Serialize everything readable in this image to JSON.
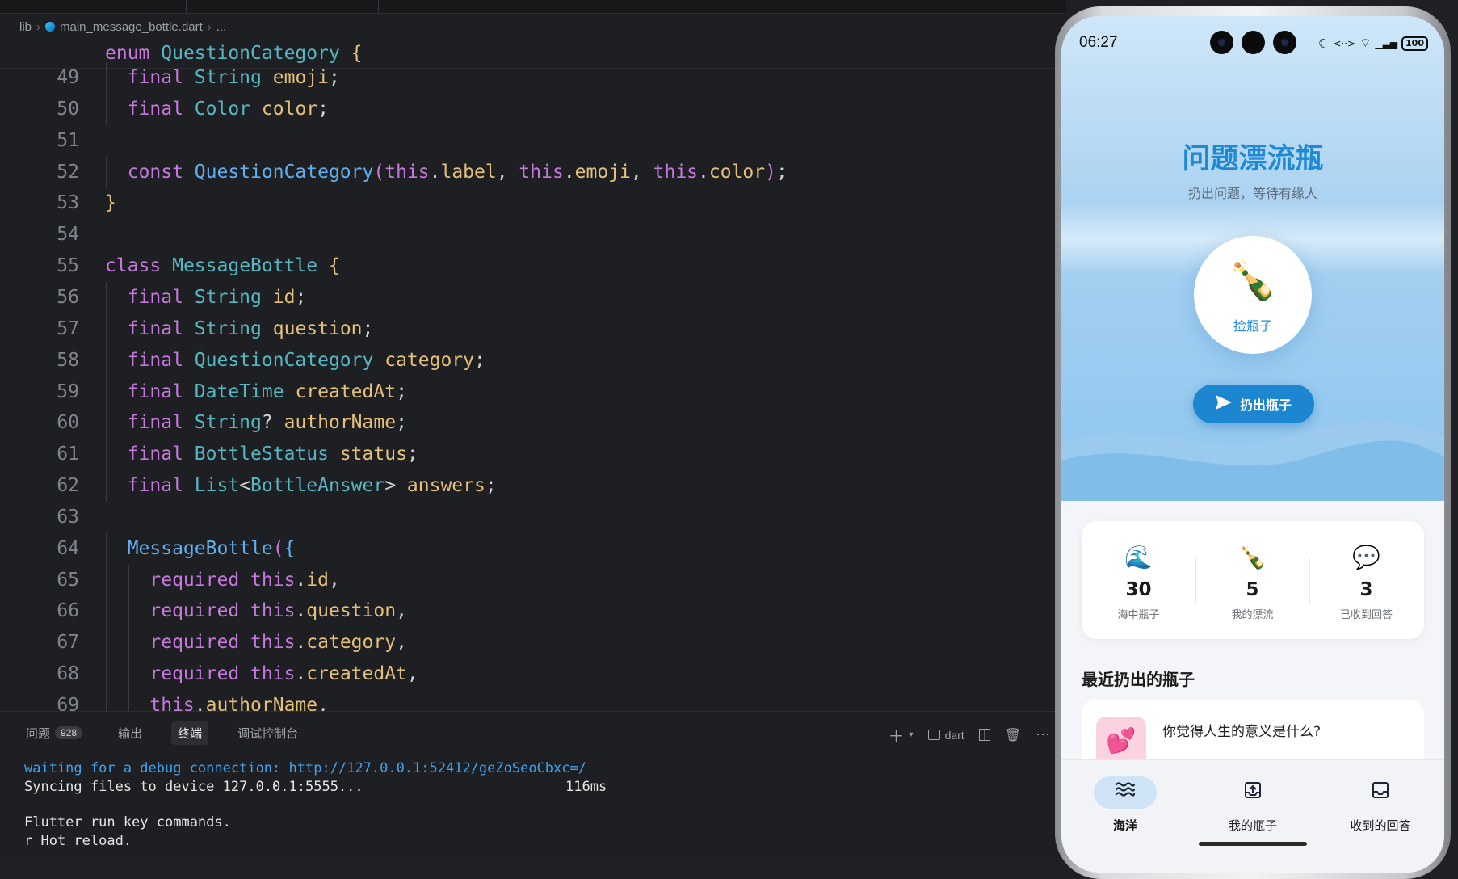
{
  "editor": {
    "breadcrumb": [
      "lib",
      "main_message_bottle.dart",
      "..."
    ],
    "sticky_line": "enum QuestionCategory {",
    "lines": [
      {
        "n": "49",
        "tokens": [
          [
            "kw",
            "final"
          ],
          [
            "pn",
            " "
          ],
          [
            "ty",
            "String"
          ],
          [
            "pn",
            " "
          ],
          [
            "vr",
            "emoji"
          ],
          [
            "pn",
            ";"
          ]
        ],
        "indent": 1
      },
      {
        "n": "50",
        "tokens": [
          [
            "kw",
            "final"
          ],
          [
            "pn",
            " "
          ],
          [
            "ty",
            "Color"
          ],
          [
            "pn",
            " "
          ],
          [
            "vr",
            "color"
          ],
          [
            "pn",
            ";"
          ]
        ],
        "indent": 1
      },
      {
        "n": "51",
        "tokens": [],
        "indent": 0
      },
      {
        "n": "52",
        "tokens": [
          [
            "kw",
            "const"
          ],
          [
            "pn",
            " "
          ],
          [
            "fn",
            "QuestionCategory"
          ],
          [
            "br2",
            "("
          ],
          [
            "th",
            "this"
          ],
          [
            "pn",
            "."
          ],
          [
            "vr",
            "label"
          ],
          [
            "pn",
            ", "
          ],
          [
            "th",
            "this"
          ],
          [
            "pn",
            "."
          ],
          [
            "vr",
            "emoji"
          ],
          [
            "pn",
            ", "
          ],
          [
            "th",
            "this"
          ],
          [
            "pn",
            "."
          ],
          [
            "vr",
            "color"
          ],
          [
            "br2",
            ")"
          ],
          [
            "pn",
            ";"
          ]
        ],
        "indent": 1
      },
      {
        "n": "53",
        "tokens": [
          [
            "br1",
            "}"
          ]
        ],
        "indent": 0
      },
      {
        "n": "54",
        "tokens": [],
        "indent": 0
      },
      {
        "n": "55",
        "tokens": [
          [
            "kw",
            "class"
          ],
          [
            "pn",
            " "
          ],
          [
            "ty",
            "MessageBottle"
          ],
          [
            "pn",
            " "
          ],
          [
            "br1",
            "{"
          ]
        ],
        "indent": 0
      },
      {
        "n": "56",
        "tokens": [
          [
            "kw",
            "final"
          ],
          [
            "pn",
            " "
          ],
          [
            "ty",
            "String"
          ],
          [
            "pn",
            " "
          ],
          [
            "vr",
            "id"
          ],
          [
            "pn",
            ";"
          ]
        ],
        "indent": 1
      },
      {
        "n": "57",
        "tokens": [
          [
            "kw",
            "final"
          ],
          [
            "pn",
            " "
          ],
          [
            "ty",
            "String"
          ],
          [
            "pn",
            " "
          ],
          [
            "vr",
            "question"
          ],
          [
            "pn",
            ";"
          ]
        ],
        "indent": 1
      },
      {
        "n": "58",
        "tokens": [
          [
            "kw",
            "final"
          ],
          [
            "pn",
            " "
          ],
          [
            "ty",
            "QuestionCategory"
          ],
          [
            "pn",
            " "
          ],
          [
            "vr",
            "category"
          ],
          [
            "pn",
            ";"
          ]
        ],
        "indent": 1
      },
      {
        "n": "59",
        "tokens": [
          [
            "kw",
            "final"
          ],
          [
            "pn",
            " "
          ],
          [
            "ty",
            "DateTime"
          ],
          [
            "pn",
            " "
          ],
          [
            "vr",
            "createdAt"
          ],
          [
            "pn",
            ";"
          ]
        ],
        "indent": 1
      },
      {
        "n": "60",
        "tokens": [
          [
            "kw",
            "final"
          ],
          [
            "pn",
            " "
          ],
          [
            "ty",
            "String"
          ],
          [
            "pn",
            "? "
          ],
          [
            "vr",
            "authorName"
          ],
          [
            "pn",
            ";"
          ]
        ],
        "indent": 1
      },
      {
        "n": "61",
        "tokens": [
          [
            "kw",
            "final"
          ],
          [
            "pn",
            " "
          ],
          [
            "ty",
            "BottleStatus"
          ],
          [
            "pn",
            " "
          ],
          [
            "vr",
            "status"
          ],
          [
            "pn",
            ";"
          ]
        ],
        "indent": 1
      },
      {
        "n": "62",
        "tokens": [
          [
            "kw",
            "final"
          ],
          [
            "pn",
            " "
          ],
          [
            "ty",
            "List"
          ],
          [
            "pn",
            "<"
          ],
          [
            "ty",
            "BottleAnswer"
          ],
          [
            "pn",
            "> "
          ],
          [
            "vr",
            "answers"
          ],
          [
            "pn",
            ";"
          ]
        ],
        "indent": 1
      },
      {
        "n": "63",
        "tokens": [],
        "indent": 0
      },
      {
        "n": "64",
        "tokens": [
          [
            "fn",
            "MessageBottle"
          ],
          [
            "br2",
            "("
          ],
          [
            "br3",
            "{"
          ]
        ],
        "indent": 1
      },
      {
        "n": "65",
        "tokens": [
          [
            "kw",
            "required"
          ],
          [
            "pn",
            " "
          ],
          [
            "th",
            "this"
          ],
          [
            "pn",
            "."
          ],
          [
            "vr",
            "id"
          ],
          [
            "pn",
            ","
          ]
        ],
        "indent": 2
      },
      {
        "n": "66",
        "tokens": [
          [
            "kw",
            "required"
          ],
          [
            "pn",
            " "
          ],
          [
            "th",
            "this"
          ],
          [
            "pn",
            "."
          ],
          [
            "vr",
            "question"
          ],
          [
            "pn",
            ","
          ]
        ],
        "indent": 2
      },
      {
        "n": "67",
        "tokens": [
          [
            "kw",
            "required"
          ],
          [
            "pn",
            " "
          ],
          [
            "th",
            "this"
          ],
          [
            "pn",
            "."
          ],
          [
            "vr",
            "category"
          ],
          [
            "pn",
            ","
          ]
        ],
        "indent": 2
      },
      {
        "n": "68",
        "tokens": [
          [
            "kw",
            "required"
          ],
          [
            "pn",
            " "
          ],
          [
            "th",
            "this"
          ],
          [
            "pn",
            "."
          ],
          [
            "vr",
            "createdAt"
          ],
          [
            "pn",
            ","
          ]
        ],
        "indent": 2
      },
      {
        "n": "69",
        "tokens": [
          [
            "th",
            "this"
          ],
          [
            "pn",
            "."
          ],
          [
            "vr",
            "authorName"
          ],
          [
            "pn",
            ","
          ]
        ],
        "indent": 2
      }
    ]
  },
  "panel": {
    "tabs": [
      {
        "label": "问题",
        "badge": "928"
      },
      {
        "label": "输出"
      },
      {
        "label": "终端"
      },
      {
        "label": "调试控制台"
      }
    ],
    "active_tab": "终端",
    "terminal_profile": "dart",
    "terminal": {
      "line1": "waiting for a debug connection: http://127.0.0.1:52412/geZoSeoCbxc=/",
      "line2": "Syncing files to device 127.0.0.1:5555...",
      "line2_time": "116ms",
      "line3": "Flutter run key commands.",
      "line4": "r Hot reload."
    }
  },
  "phone": {
    "time": "06:27",
    "battery": "100",
    "title": "问题漂流瓶",
    "subtitle": "扔出问题，等待有缘人",
    "pick_label": "捡瓶子",
    "pick_icon": "🍾",
    "throw_label": "扔出瓶子",
    "stats": [
      {
        "icon": "🌊",
        "value": "30",
        "label": "海中瓶子"
      },
      {
        "icon": "🍾",
        "value": "5",
        "label": "我的漂流"
      },
      {
        "icon": "💬",
        "value": "3",
        "label": "已收到回答"
      }
    ],
    "recent_title": "最近扔出的瓶子",
    "recent_item": {
      "icon": "💕",
      "question": "你觉得人生的意义是什么?"
    },
    "nav": [
      {
        "label": "海洋",
        "icon": "waves-icon"
      },
      {
        "label": "我的瓶子",
        "icon": "upload-box-icon"
      },
      {
        "label": "收到的回答",
        "icon": "inbox-icon"
      }
    ],
    "colors": {
      "accent": "#1d86d0",
      "title": "#1f8ad3"
    }
  }
}
